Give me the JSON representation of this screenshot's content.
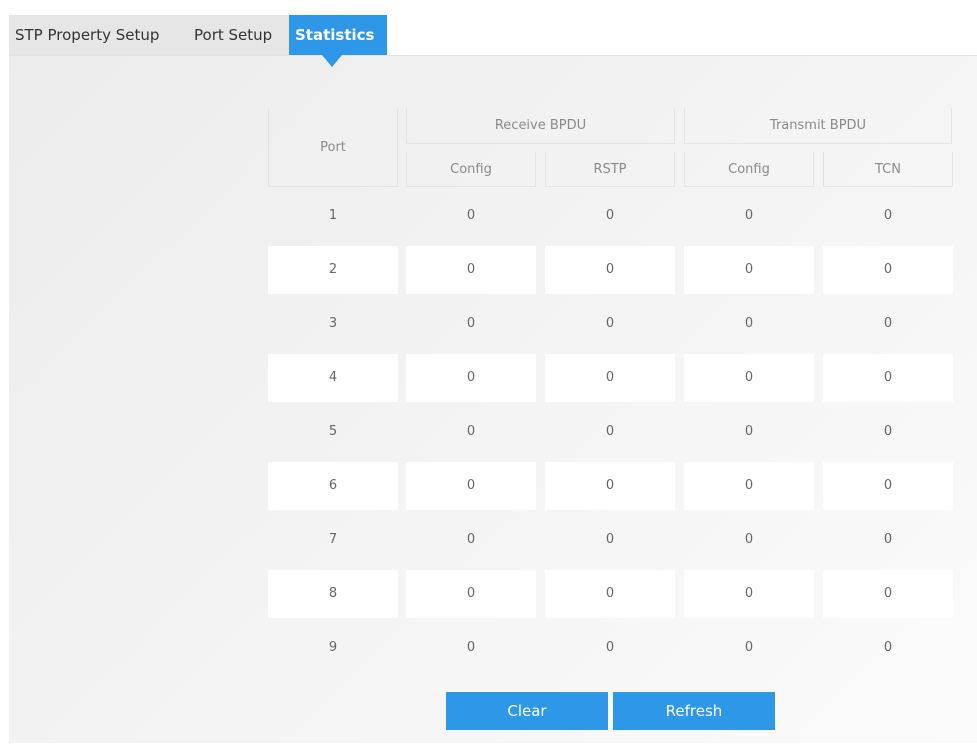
{
  "tabs": [
    {
      "label": "STP Property Setup",
      "active": false
    },
    {
      "label": "Port Setup",
      "active": false
    },
    {
      "label": "Statistics",
      "active": true
    }
  ],
  "table": {
    "port_header": "Port",
    "receive_header": "Receive BPDU",
    "transmit_header": "Transmit BPDU",
    "sub_headers": [
      "Config",
      "RSTP",
      "Config",
      "TCN"
    ],
    "rows": [
      {
        "port": "1",
        "values": [
          "0",
          "0",
          "0",
          "0"
        ]
      },
      {
        "port": "2",
        "values": [
          "0",
          "0",
          "0",
          "0"
        ]
      },
      {
        "port": "3",
        "values": [
          "0",
          "0",
          "0",
          "0"
        ]
      },
      {
        "port": "4",
        "values": [
          "0",
          "0",
          "0",
          "0"
        ]
      },
      {
        "port": "5",
        "values": [
          "0",
          "0",
          "0",
          "0"
        ]
      },
      {
        "port": "6",
        "values": [
          "0",
          "0",
          "0",
          "0"
        ]
      },
      {
        "port": "7",
        "values": [
          "0",
          "0",
          "0",
          "0"
        ]
      },
      {
        "port": "8",
        "values": [
          "0",
          "0",
          "0",
          "0"
        ]
      },
      {
        "port": "9",
        "values": [
          "0",
          "0",
          "0",
          "0"
        ]
      }
    ]
  },
  "buttons": {
    "clear": "Clear",
    "refresh": "Refresh"
  },
  "colors": {
    "accent": "#2e97e8"
  }
}
